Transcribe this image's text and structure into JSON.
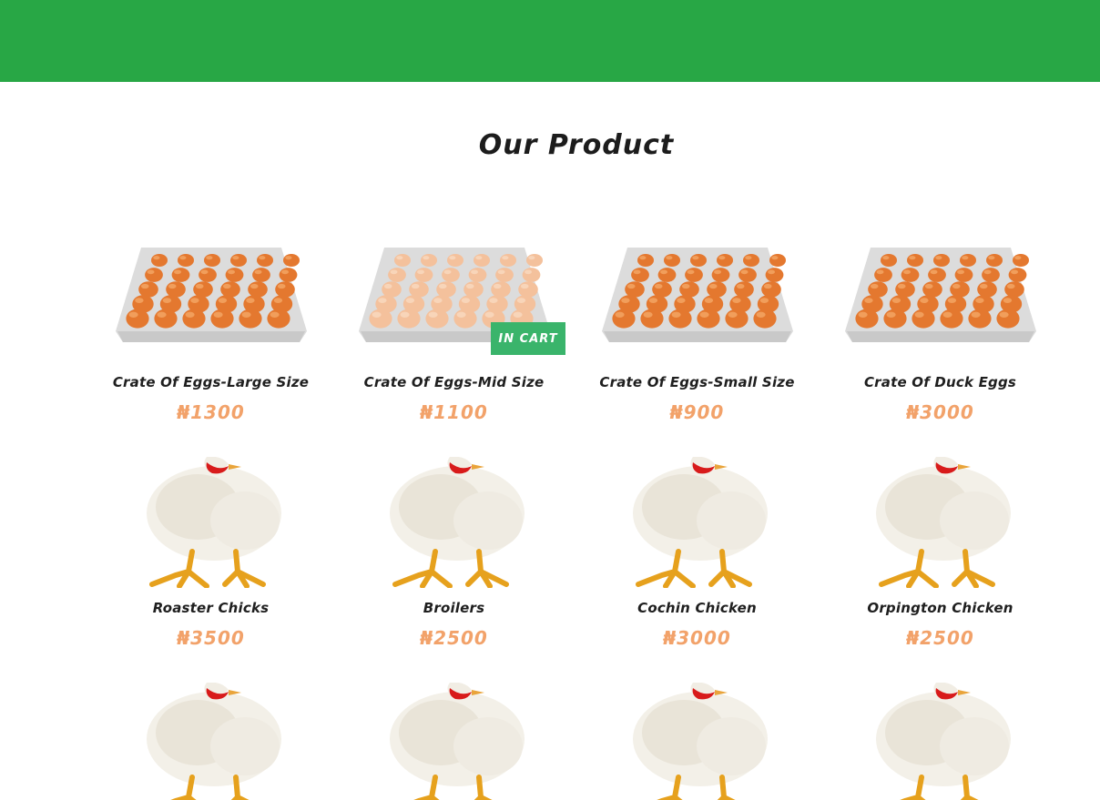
{
  "section": {
    "title": "Our Product"
  },
  "currency": "₦",
  "products": [
    {
      "name": "Crate Of Eggs-Large Size",
      "price": "₦1300",
      "image": "egg-crate-brown"
    },
    {
      "name": "Crate Of Eggs-Mid Size",
      "price": "₦1100",
      "image": "egg-crate-light",
      "badge": "IN CART"
    },
    {
      "name": "Crate Of Eggs-Small Size",
      "price": "₦900",
      "image": "egg-crate-brown"
    },
    {
      "name": "Crate Of Duck Eggs",
      "price": "₦3000",
      "image": "egg-crate-brown"
    },
    {
      "name": "Roaster Chicks",
      "price": "₦3500",
      "image": "white-chicken"
    },
    {
      "name": "Broilers",
      "price": "₦2500",
      "image": "white-chicken"
    },
    {
      "name": "Cochin Chicken",
      "price": "₦3000",
      "image": "white-chicken"
    },
    {
      "name": "Orpington Chicken",
      "price": "₦2500",
      "image": "white-chicken"
    },
    {
      "name": "",
      "price": "",
      "image": "white-chicken"
    },
    {
      "name": "",
      "price": "",
      "image": "white-chicken"
    },
    {
      "name": "",
      "price": "",
      "image": "white-chicken"
    },
    {
      "name": "",
      "price": "",
      "image": "white-chicken"
    }
  ],
  "colors": {
    "header_green": "#28a745",
    "price_orange": "#f2a26a",
    "badge_green": "#3ab46b",
    "egg_brown": "#e07a35",
    "egg_light": "#f3b88f"
  }
}
